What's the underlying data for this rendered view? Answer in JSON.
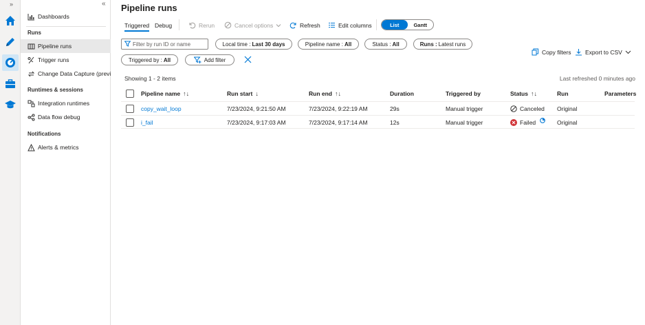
{
  "rail": {
    "expand_glyph": "»"
  },
  "sidebar": {
    "collapse_glyph": "«",
    "dashboards": "Dashboards",
    "runs_section": "Runs",
    "runs_items": [
      "Pipeline runs",
      "Trigger runs",
      "Change Data Capture (previ..."
    ],
    "runtimes_section": "Runtimes & sessions",
    "runtimes_items": [
      "Integration runtimes",
      "Data flow debug"
    ],
    "notifications_section": "Notifications",
    "notifications_items": [
      "Alerts & metrics"
    ]
  },
  "page": {
    "title": "Pipeline runs"
  },
  "tabs": [
    "Triggered",
    "Debug"
  ],
  "toolbar": {
    "rerun": "Rerun",
    "cancel_options": "Cancel options",
    "refresh": "Refresh",
    "edit_columns": "Edit columns",
    "view_list": "List",
    "view_gantt": "Gantt"
  },
  "filters": {
    "search_placeholder": "Filter by run ID or name",
    "local_time_label": "Local time :",
    "local_time_value": "Last 30 days",
    "pipeline_name_label": "Pipeline name :",
    "pipeline_name_value": "All",
    "status_label": "Status :",
    "status_value": "All",
    "runs_label": "Runs :",
    "runs_value": "Latest runs",
    "triggered_by_label": "Triggered by :",
    "triggered_by_value": "All",
    "add_filter": "Add filter"
  },
  "actions": {
    "copy_filters": "Copy filters",
    "export_csv": "Export to CSV"
  },
  "summary": {
    "showing": "Showing 1 - 2 items",
    "last_refreshed": "Last refreshed 0 minutes ago"
  },
  "table": {
    "headers": {
      "pipeline_name": "Pipeline name",
      "run_start": "Run start",
      "run_end": "Run end",
      "duration": "Duration",
      "triggered_by": "Triggered by",
      "status": "Status",
      "run": "Run",
      "parameters": "Parameters"
    },
    "rows": [
      {
        "pipeline_name": "copy_wait_loop",
        "run_start": "7/23/2024, 9:21:50 AM",
        "run_end": "7/23/2024, 9:22:19 AM",
        "duration": "29s",
        "triggered_by": "Manual trigger",
        "status": "Canceled",
        "run": "Original"
      },
      {
        "pipeline_name": "i_fail",
        "run_start": "7/23/2024, 9:17:03 AM",
        "run_end": "7/23/2024, 9:17:14 AM",
        "duration": "12s",
        "triggered_by": "Manual trigger",
        "status": "Failed",
        "run": "Original"
      }
    ]
  },
  "colors": {
    "accent": "#0078d4",
    "failed": "#d13438",
    "rail_bg": "#f3f2f1"
  }
}
